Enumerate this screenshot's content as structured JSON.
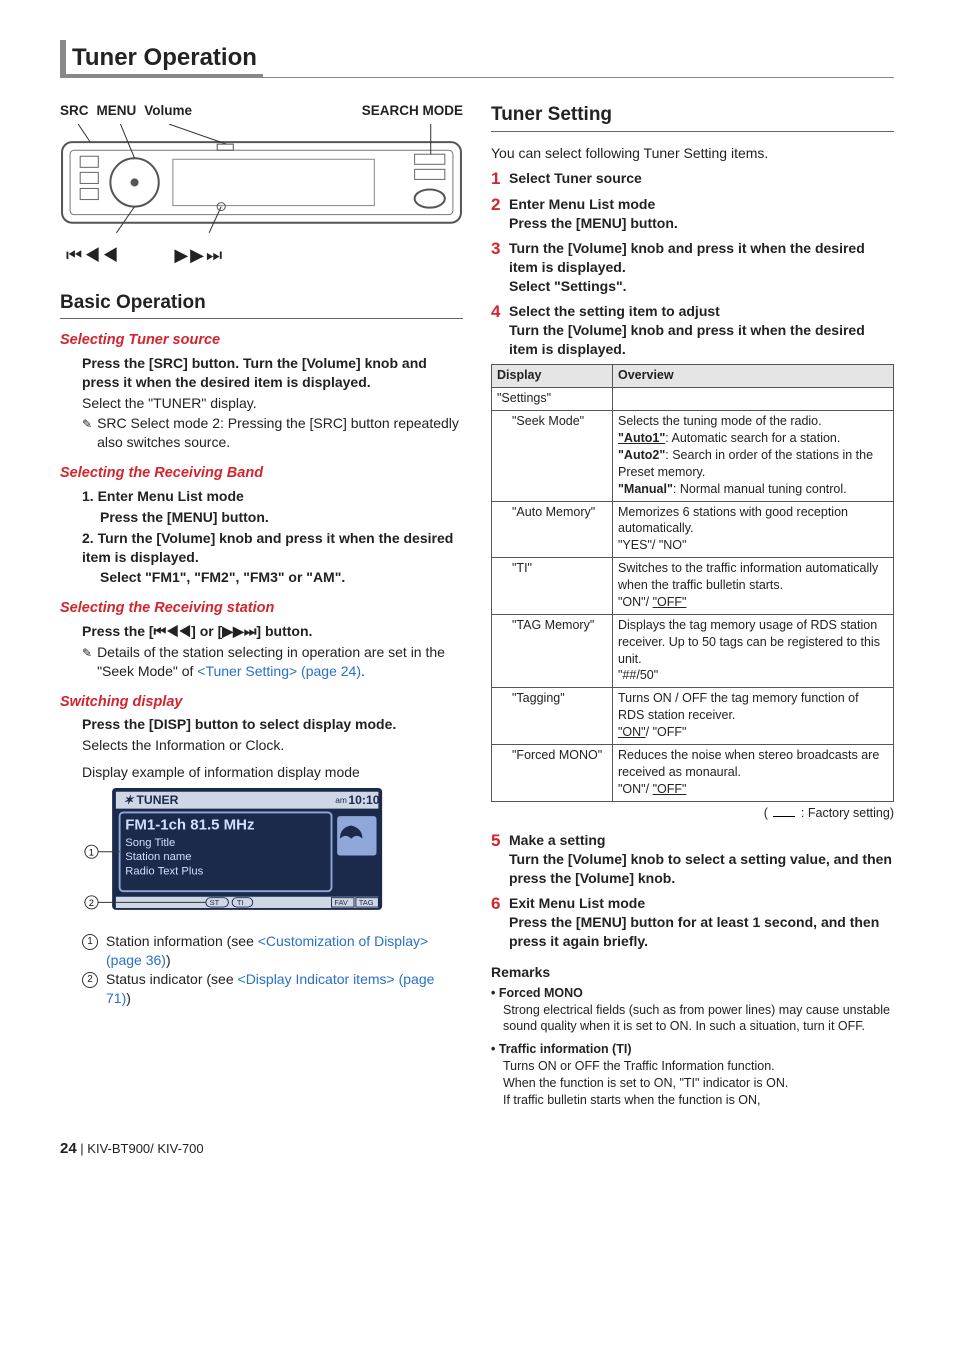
{
  "title": "Tuner Operation",
  "diagram": {
    "labels": {
      "src": "SRC",
      "menu": "MENU",
      "volume": "Volume",
      "search_mode": "SEARCH MODE"
    },
    "bottom_left": "⏮◀◀",
    "bottom_right": "▶▶⏭"
  },
  "left": {
    "basic_operation": "Basic Operation",
    "sel_tuner_src_h": "Selecting Tuner source",
    "sel_tuner_src_b1": "Press the [SRC] button. Turn the [Volume] knob and press it when the desired item is displayed.",
    "sel_tuner_src_b2": "Select the \"TUNER\" display.",
    "sel_tuner_src_note": "SRC Select mode 2: Pressing the [SRC] button repeatedly also switches source.",
    "sel_band_h": "Selecting the Receiving Band",
    "sel_band_1a": "1. Enter Menu List mode",
    "sel_band_1b": "Press the [MENU] button.",
    "sel_band_2a": "2. Turn the [Volume] knob and press it when the desired item is displayed.",
    "sel_band_2b": "Select \"FM1\", \"FM2\", \"FM3\" or \"AM\".",
    "sel_station_h": "Selecting the Receiving station",
    "sel_station_b1a": "Press the [",
    "sel_station_skipL": "⏮◀◀",
    "sel_station_b1b": "] or [",
    "sel_station_skipR": "▶▶⏭",
    "sel_station_b1c": "] button.",
    "sel_station_note_a": "Details of the station selecting in operation are set in the \"Seek Mode\" of ",
    "sel_station_note_link": "<Tuner Setting> (page 24)",
    "sel_station_note_b": ".",
    "switch_disp_h": "Switching display",
    "switch_disp_b1": "Press the [DISP] button to select display mode.",
    "switch_disp_b2": "Selects the Information or Clock.",
    "disp_example_title": "Display example of information display mode",
    "disp_tuner": "TUNER",
    "disp_time": "10:10",
    "disp_ampm": "am",
    "disp_freq": "FM1-1ch 81.5 MHz",
    "disp_l1": "Song Title",
    "disp_l2": "Station name",
    "disp_l3": "Radio Text Plus",
    "disp_st": "ST",
    "disp_ti": "TI",
    "disp_fav": "FAV",
    "disp_tag": "TAG",
    "callout1_a": "Station information (see ",
    "callout1_link": "<Customization of Display> (page 36)",
    "callout1_b": ")",
    "callout2_a": "Status indicator (see ",
    "callout2_link": "<Display Indicator items> (page 71)",
    "callout2_b": ")"
  },
  "right": {
    "tuner_setting_h": "Tuner Setting",
    "intro": "You can select following Tuner Setting items.",
    "step1": "Select Tuner source",
    "step2a": "Enter Menu List mode",
    "step2b": "Press the [MENU] button.",
    "step3a": "Turn the [Volume] knob and press it when the desired item is displayed.",
    "step3b": "Select \"Settings\".",
    "step4a": "Select the setting item to adjust",
    "step4b": "Turn the [Volume] knob and press it when the desired item is displayed.",
    "table": {
      "th_display": "Display",
      "th_overview": "Overview",
      "r0": "\"Settings\"",
      "r1d": "\"Seek Mode\"",
      "r1_a": "Selects the tuning mode of the radio.",
      "r1_b": "\"Auto1\"",
      "r1_bt": ": Automatic search for a station.",
      "r1_c": "\"Auto2\"",
      "r1_ct": ": Search in order of the stations in the Preset memory.",
      "r1_d": "\"Manual\"",
      "r1_dt": ": Normal manual tuning control.",
      "r2d": "\"Auto Memory\"",
      "r2_a": "Memorizes 6 stations with good reception automatically.",
      "r2_b": "\"YES\"/ \"NO\"",
      "r3d": "\"TI\"",
      "r3_a": "Switches to the traffic information automatically when the traffic bulletin starts.",
      "r3_b_on": "\"ON\"/ ",
      "r3_b_off": "\"OFF\"",
      "r4d": "\"TAG Memory\"",
      "r4_a": "Displays the tag memory usage of RDS station receiver. Up to 50 tags can be registered to this unit.",
      "r4_b": "\"##/50\"",
      "r5d": "\"Tagging\"",
      "r5_a": "Turns ON / OFF the tag memory function of RDS station receiver.",
      "r5_b_on": "\"ON\"",
      "r5_b_off": "/ \"OFF\"",
      "r6d": "\"Forced MONO\"",
      "r6_a": "Reduces the noise when stereo broadcasts are received as monaural.",
      "r6_b_on": "\"ON\"/ ",
      "r6_b_off": "\"OFF\""
    },
    "factory_legend": " : Factory setting)",
    "step5a": "Make a setting",
    "step5b": "Turn the [Volume] knob to select a setting value, and then press the [Volume] knob.",
    "step6a": "Exit Menu List mode",
    "step6b": "Press the [MENU] button for at least 1 second, and then press it again briefly.",
    "remarks_h": "Remarks",
    "rem1_t": "Forced MONO",
    "rem1_b": "Strong electrical fields (such as from power lines) may cause unstable sound quality when it is set to ON. In such a situation, turn it OFF.",
    "rem2_t": "Traffic information (TI)",
    "rem2_b1": "Turns ON or OFF the Traffic Information function.",
    "rem2_b2": "When the function is set to ON, \"TI\" indicator is ON.",
    "rem2_b3": "If traffic bulletin starts when the function is ON,"
  },
  "footer": {
    "page": "24",
    "sep": "   |   ",
    "model": "KIV-BT900/ KIV-700"
  }
}
